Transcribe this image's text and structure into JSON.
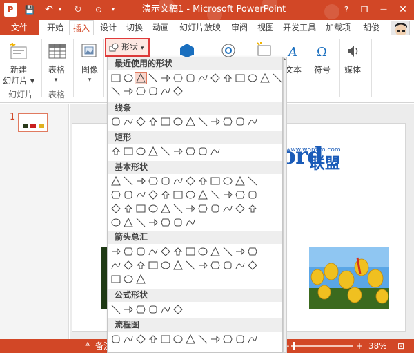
{
  "app": {
    "title": "演示文稿1 - Microsoft PowerPoint",
    "quick_access": {
      "save": "💾",
      "undo": "↶",
      "redo": "↻",
      "help": "?"
    },
    "window_buttons": {
      "restore": "❐",
      "minimize": "—",
      "close": "✕"
    }
  },
  "tabs": [
    "文件",
    "开始",
    "插入",
    "设计",
    "切换",
    "动画",
    "幻灯片放映",
    "审阅",
    "视图",
    "开发工具",
    "加载项",
    "胡俊"
  ],
  "ribbon": {
    "new_slide": "新建\n幻灯片",
    "new_slide_line1": "新建",
    "new_slide_line2": "幻灯片 ▾",
    "slides_group": "幻灯片",
    "table": "表格",
    "table_arrow": "▾",
    "table_group": "表格",
    "image": "图像",
    "image_arrow": "▾",
    "shapes": "形状",
    "text": "文本",
    "symbol": "符号",
    "media": "媒体",
    "dropdown_arrow": "▾"
  },
  "dropdown": {
    "categories": [
      "最近使用的形状",
      "线条",
      "矩形",
      "基本形状",
      "箭头总汇",
      "公式形状",
      "流程图"
    ]
  },
  "slides_pane": {
    "slide_number": "1"
  },
  "watermark": {
    "brand": "Word",
    "cn": "联盟",
    "url": "www.wordlm.com"
  },
  "status": {
    "notes": "备注",
    "zoom": "38%",
    "plus": "+"
  },
  "colors": {
    "accent": "#d24726",
    "highlight": "#e03a3a",
    "logo": "#1a5bb8"
  }
}
